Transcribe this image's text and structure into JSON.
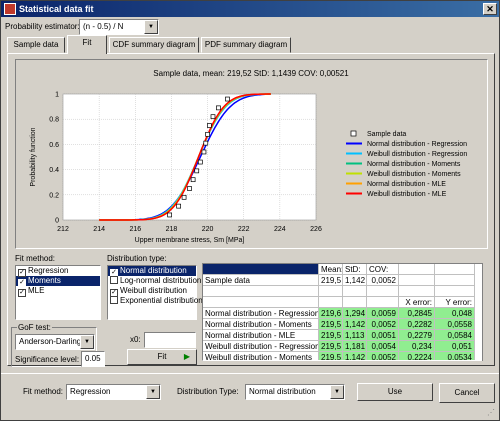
{
  "window": {
    "title": "Statistical data fit"
  },
  "estimator": {
    "label": "Probability estimator:",
    "value": "(n - 0.5) / N"
  },
  "tabs": [
    {
      "label": "Sample data"
    },
    {
      "label": "Fit"
    },
    {
      "label": "CDF summary diagram"
    },
    {
      "label": "PDF summary diagram"
    }
  ],
  "chart_data": {
    "type": "line",
    "title": "Sample data, mean: 219,52 StD: 1,1439 COV: 0,00521",
    "xlabel": "Upper membrane stress, Sm [MPa]",
    "ylabel": "Probability function",
    "xlim": [
      212,
      226
    ],
    "ylim": [
      0,
      1
    ],
    "x_ticks": [
      "212",
      "214",
      "216",
      "218",
      "220",
      "222",
      "224",
      "226"
    ],
    "y_ticks": [
      "0",
      "0.2",
      "0.4",
      "0.6",
      "0.8",
      "1"
    ],
    "grid": true,
    "legend_position": "right",
    "sample_points": {
      "name": "Sample data",
      "x": [
        217.9,
        218.4,
        218.7,
        219.0,
        219.2,
        219.4,
        219.6,
        219.8,
        219.9,
        220.0,
        220.1,
        220.3,
        220.6,
        221.1
      ],
      "y": [
        0.04,
        0.11,
        0.18,
        0.25,
        0.32,
        0.39,
        0.46,
        0.54,
        0.61,
        0.68,
        0.75,
        0.82,
        0.89,
        0.96
      ]
    },
    "series": [
      {
        "name": "Normal distribution - Regression",
        "color": "#0000ff",
        "mean": 219.6,
        "std": 1.294
      },
      {
        "name": "Weibull distribution - Regression",
        "color": "#00c0ff",
        "mean": 219.5,
        "std": 1.181
      },
      {
        "name": "Normal distribution - Moments",
        "color": "#00c080",
        "mean": 219.5,
        "std": 1.142
      },
      {
        "name": "Weibull distribution - Moments",
        "color": "#c0e000",
        "mean": 219.5,
        "std": 1.142
      },
      {
        "name": "Normal distribution - MLE",
        "color": "#ffa000",
        "mean": 219.5,
        "std": 1.113
      },
      {
        "name": "Weibull distribution - MLE",
        "color": "#ff0000",
        "mean": 219.5,
        "std": 1.1
      }
    ]
  },
  "fit_method": {
    "label": "Fit method:",
    "items": [
      {
        "label": "Regression",
        "checked": true,
        "selected": false
      },
      {
        "label": "Moments",
        "checked": true,
        "selected": true
      },
      {
        "label": "MLE",
        "checked": true,
        "selected": false
      }
    ]
  },
  "distribution_type": {
    "label": "Distribution type:",
    "items": [
      {
        "label": "Normal distribution",
        "checked": true,
        "selected": true
      },
      {
        "label": "Log-normal distribution",
        "checked": false,
        "selected": false
      },
      {
        "label": "Weibull distribution",
        "checked": true,
        "selected": false
      },
      {
        "label": "Exponential distribution",
        "checked": false,
        "selected": false
      }
    ]
  },
  "gof": {
    "label": "GoF test:",
    "value": "Anderson-Darling",
    "sig_label": "Significance level:",
    "sig_value": "0.05"
  },
  "x0": {
    "label": "x0:",
    "value": ""
  },
  "fit_button": "Fit",
  "results": {
    "headers": [
      "",
      "Mean:",
      "StD:",
      "COV:",
      "",
      ""
    ],
    "subheaders": [
      "",
      "",
      "",
      "",
      "X error:",
      "Y error:"
    ],
    "rows": [
      {
        "name": "Sample data",
        "mean": "219,5",
        "std": "1,142",
        "cov": "0,0052",
        "xerr": "",
        "yerr": "",
        "green": false
      },
      {
        "name": "",
        "mean": "",
        "std": "",
        "cov": "",
        "xerr": "",
        "yerr": "",
        "green": false
      },
      {
        "name": "Normal distribution - Regression",
        "mean": "219,6",
        "std": "1,294",
        "cov": "0,0059",
        "xerr": "0,2845",
        "yerr": "0,048",
        "green": true
      },
      {
        "name": "Normal distribution - Moments",
        "mean": "219,5",
        "std": "1,142",
        "cov": "0,0052",
        "xerr": "0,2282",
        "yerr": "0,0558",
        "green": true
      },
      {
        "name": "Normal distribution - MLE",
        "mean": "219,5",
        "std": "1,113",
        "cov": "0,0051",
        "xerr": "0,2279",
        "yerr": "0,0584",
        "green": true
      },
      {
        "name": "Weibull distribution - Regression",
        "mean": "219,5",
        "std": "1,181",
        "cov": "0,0054",
        "xerr": "0,234",
        "yerr": "0,051",
        "green": true
      },
      {
        "name": "Weibull distribution - Moments",
        "mean": "219,5",
        "std": "1,142",
        "cov": "0,0052",
        "xerr": "0,2224",
        "yerr": "0,0534",
        "green": true
      }
    ]
  },
  "footer": {
    "fit_method_label": "Fit method:",
    "fit_method_value": "Regression",
    "dist_type_label": "Distribution Type:",
    "dist_type_value": "Normal distribution",
    "use_button": "Use",
    "cancel_button": "Cancel"
  }
}
